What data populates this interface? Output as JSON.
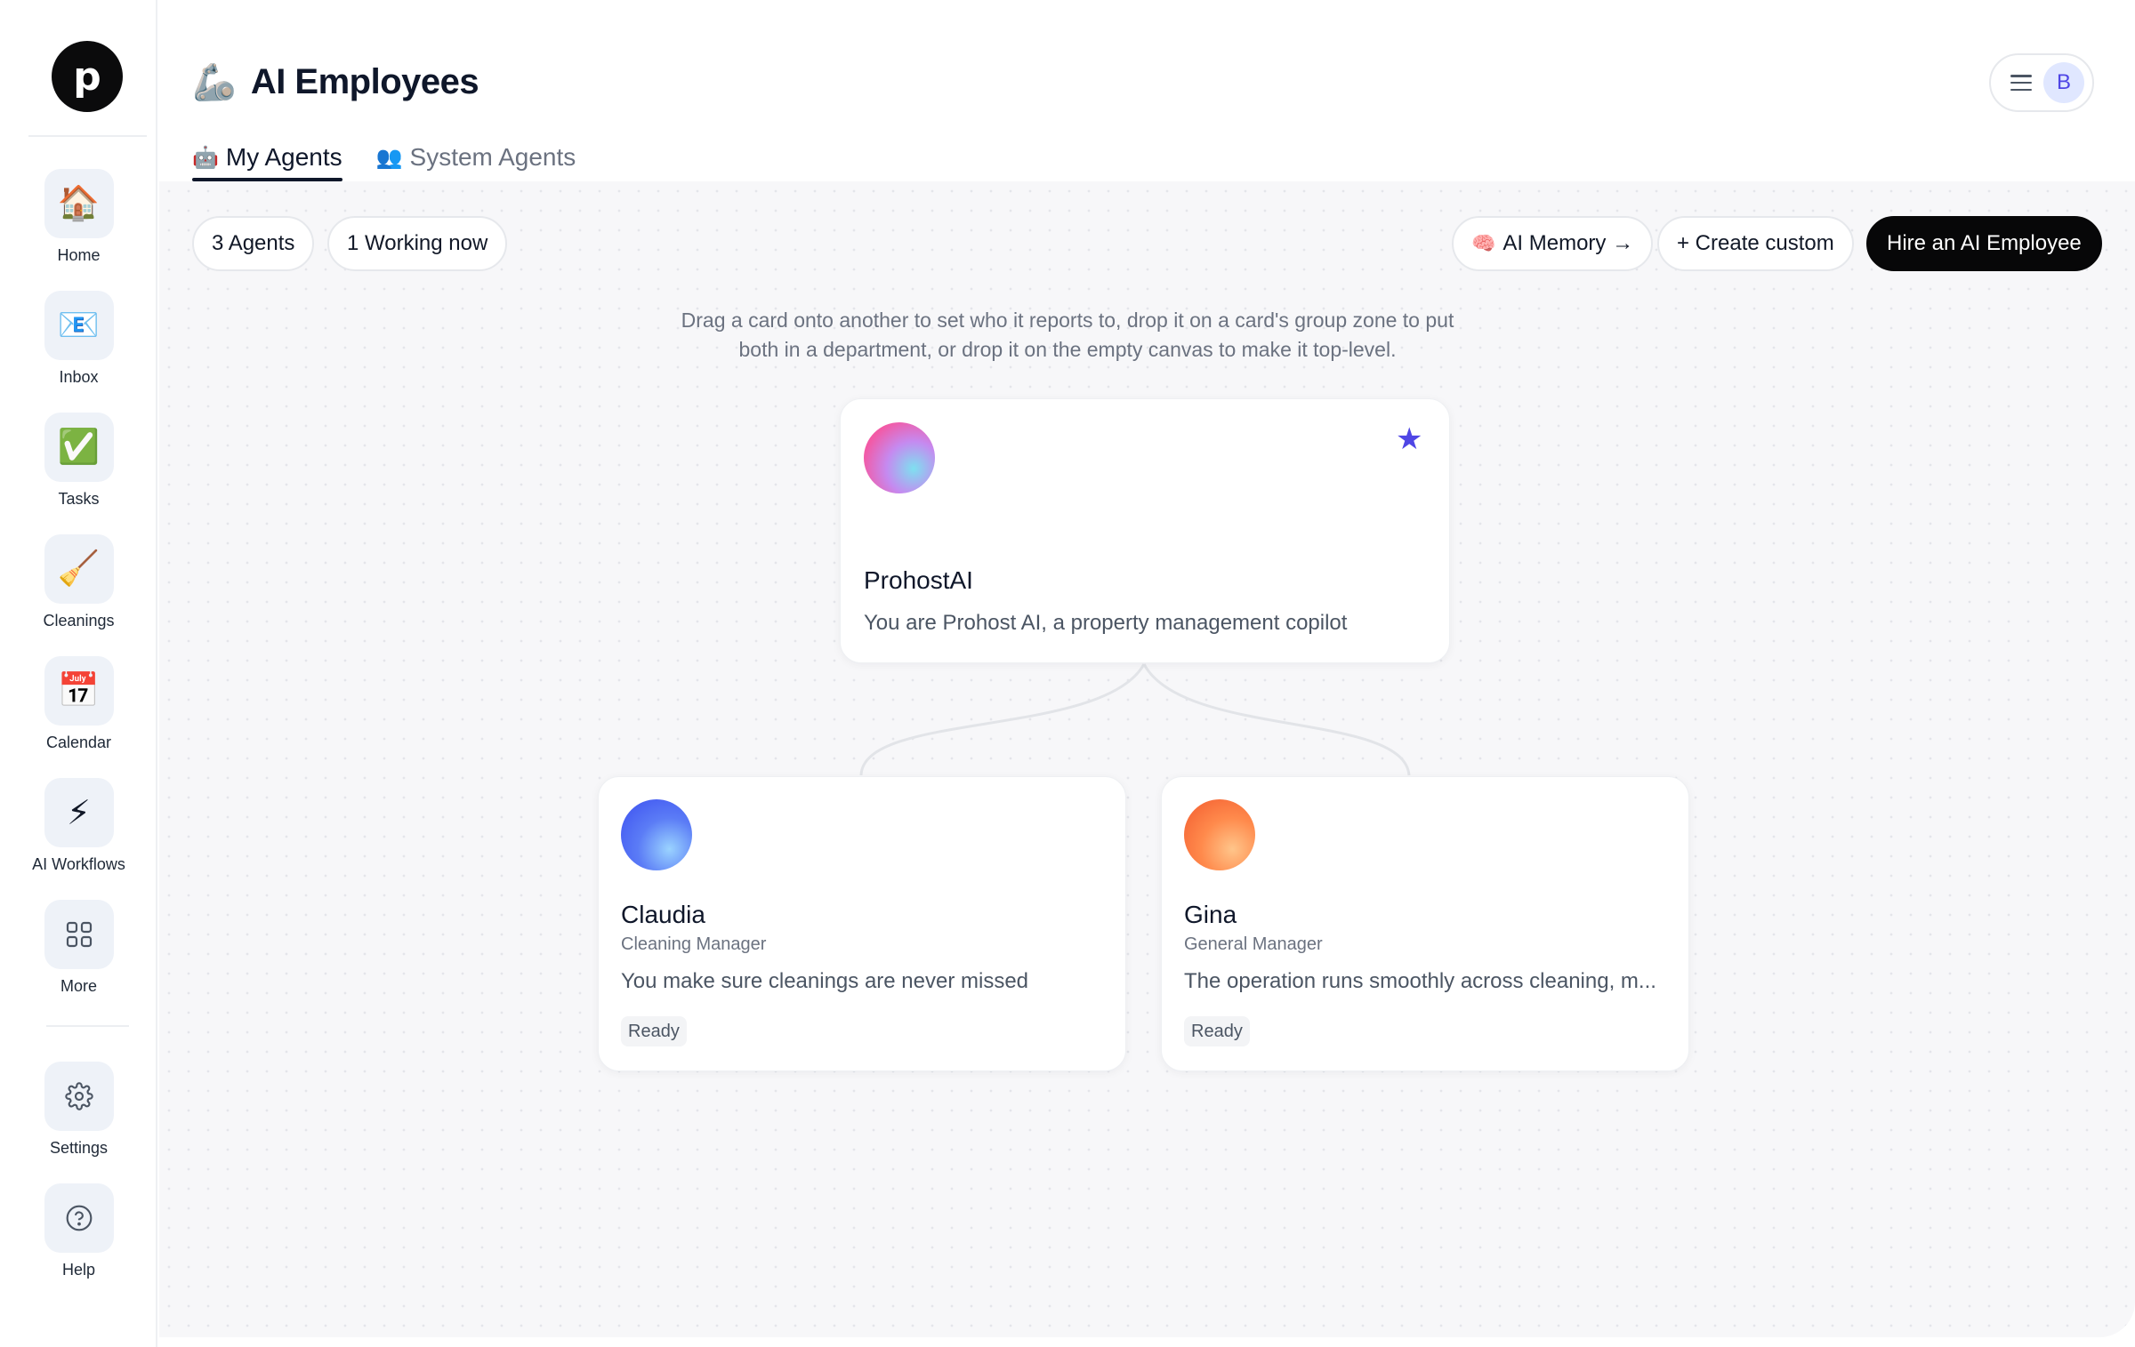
{
  "sidebar": {
    "logo": "p",
    "items": [
      {
        "label": "Home",
        "icon": "🏠"
      },
      {
        "label": "Inbox",
        "icon": "📧"
      },
      {
        "label": "Tasks",
        "icon": "✅"
      },
      {
        "label": "Cleanings",
        "icon": "🧹"
      },
      {
        "label": "Calendar",
        "icon": "📅"
      },
      {
        "label": "AI Workflows",
        "icon": "⚡"
      },
      {
        "label": "More",
        "icon": "grid-icon"
      }
    ],
    "bottom_items": [
      {
        "label": "Settings",
        "icon": "gear-icon"
      },
      {
        "label": "Help",
        "icon": "help-icon"
      }
    ]
  },
  "header": {
    "title_icon": "🦾",
    "title": "AI Employees",
    "avatar_initial": "B"
  },
  "tabs": [
    {
      "label": "My Agents",
      "icon": "🤖",
      "active": true
    },
    {
      "label": "System Agents",
      "icon": "👥",
      "active": false
    }
  ],
  "toolbar": {
    "agents_count": "3 Agents",
    "working_now": "1 Working now",
    "ai_memory": "AI Memory →",
    "ai_memory_icon": "🧠",
    "create_custom": "+ Create custom",
    "hire": "Hire an AI Employee"
  },
  "hint": {
    "line1": "Drag a card onto another to set who it reports to, drop it on a card's group zone to put",
    "line2": "both in a department, or drop it on the empty canvas to make it top-level."
  },
  "agents": [
    {
      "name": "ProhostAI",
      "role": "",
      "description": "You are Prohost AI, a property management copilot",
      "status": "",
      "starred": true,
      "orb_color": "#f2509c"
    },
    {
      "name": "Claudia",
      "role": "Cleaning Manager",
      "description": "You make sure cleanings are never missed",
      "status": "Ready",
      "starred": false,
      "orb_color": "#3b4ef0"
    },
    {
      "name": "Gina",
      "role": "General Manager",
      "description": "The operation runs smoothly across cleaning, m...",
      "status": "Ready",
      "starred": false,
      "orb_color": "#f25a2e"
    }
  ],
  "colors": {
    "accent": "#4f46e5",
    "primary_button": "#070708",
    "canvas_bg": "#f7f7f9"
  }
}
